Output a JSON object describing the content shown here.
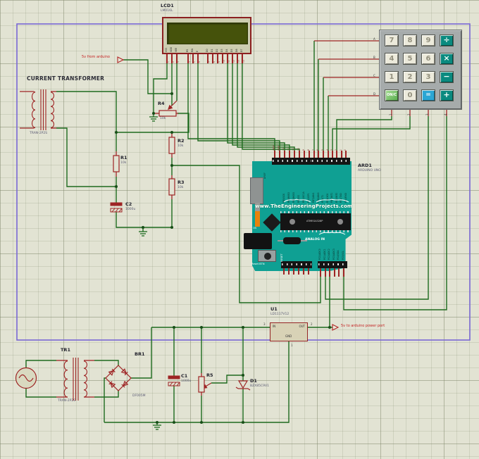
{
  "annotations": {
    "from_arduino": "5v from arduino",
    "to_arduino": "5v to arduino power port"
  },
  "current_transformer": {
    "title": "CURRENT TRANSFORMER",
    "value": "TRAN-2P2S"
  },
  "lcd": {
    "ref": "LCD1",
    "value": "LM016L",
    "pins": [
      "VSS",
      "VDD",
      "VEE",
      "RS",
      "RW",
      "E",
      "D0",
      "D1",
      "D2",
      "D3",
      "D4",
      "D5",
      "D6",
      "D7"
    ],
    "pin_numbers": [
      "1",
      "2",
      "3",
      "4",
      "5",
      "6",
      "7",
      "8",
      "9",
      "10",
      "11",
      "12",
      "13",
      "14"
    ]
  },
  "keypad": {
    "row_labels": [
      "A",
      "B",
      "C",
      "D"
    ],
    "col_labels": [
      "1",
      "2",
      "3",
      "4"
    ],
    "keys": [
      [
        "7",
        "8",
        "9",
        "÷"
      ],
      [
        "4",
        "5",
        "6",
        "×"
      ],
      [
        "1",
        "2",
        "3",
        "−"
      ],
      [
        "ON/C",
        "0",
        "=",
        "+"
      ]
    ]
  },
  "resistors": {
    "r1": {
      "ref": "R1",
      "value": "10k"
    },
    "r2": {
      "ref": "R2",
      "value": "10k"
    },
    "r3": {
      "ref": "R3",
      "value": "10k"
    },
    "r4": {
      "ref": "R4",
      "value": "10k"
    },
    "r5": {
      "ref": "R5"
    }
  },
  "capacitors": {
    "c1": {
      "ref": "C1",
      "value": "1000u"
    },
    "c2": {
      "ref": "C2",
      "value": "1000u"
    }
  },
  "diode": {
    "ref": "D1",
    "value": "BZX85C9V1"
  },
  "bridge": {
    "ref": "BR1",
    "value": "DF005M"
  },
  "transformer": {
    "ref": "TR1",
    "value": "TRAN-2P2S"
  },
  "regulator": {
    "ref": "U1",
    "value": "LD1117V12",
    "pins": {
      "in": "IN",
      "out": "OUT",
      "gnd": "GND",
      "num_in": "3",
      "num_out": "2",
      "num_gnd": "1"
    }
  },
  "arduino": {
    "ref": "ARD1",
    "value": "ARDUINO UNO",
    "board_text": {
      "url": "www.TheEngineeringProjects.com",
      "chip": "ATMEGA328P",
      "analog_in": "ANALOG IN",
      "on": "ON",
      "reset_btn": "Reset BTN",
      "reset": "RESET",
      "aref": "AREF"
    },
    "top_left_pins": [
      "AREF",
      "GND",
      "13",
      "12",
      "11",
      "10",
      "9",
      "8"
    ],
    "top_right_pins": [
      "7",
      "6",
      "5",
      "4",
      "3",
      "2",
      "1",
      "0"
    ],
    "left_port_labels": [
      "PB5/SCK",
      "PB4/MISO",
      "PB3/MOSI",
      "PB2/SS",
      "PB1/OC1A",
      "PB0/ICP1"
    ],
    "right_port_labels": [
      "PD7/AIN1",
      "PD6/AIN0",
      "PD5/T1",
      "PD4/XCK",
      "PD3/INT1",
      "PD2/INT0",
      "PD1/TXD",
      "PD0/RXD"
    ],
    "analog_labels": [
      "PC0/ADC0",
      "PC1/ADC1",
      "PC2/ADC2",
      "PC3/ADC3",
      "PC4/SDA",
      "PC5/SCL"
    ]
  }
}
